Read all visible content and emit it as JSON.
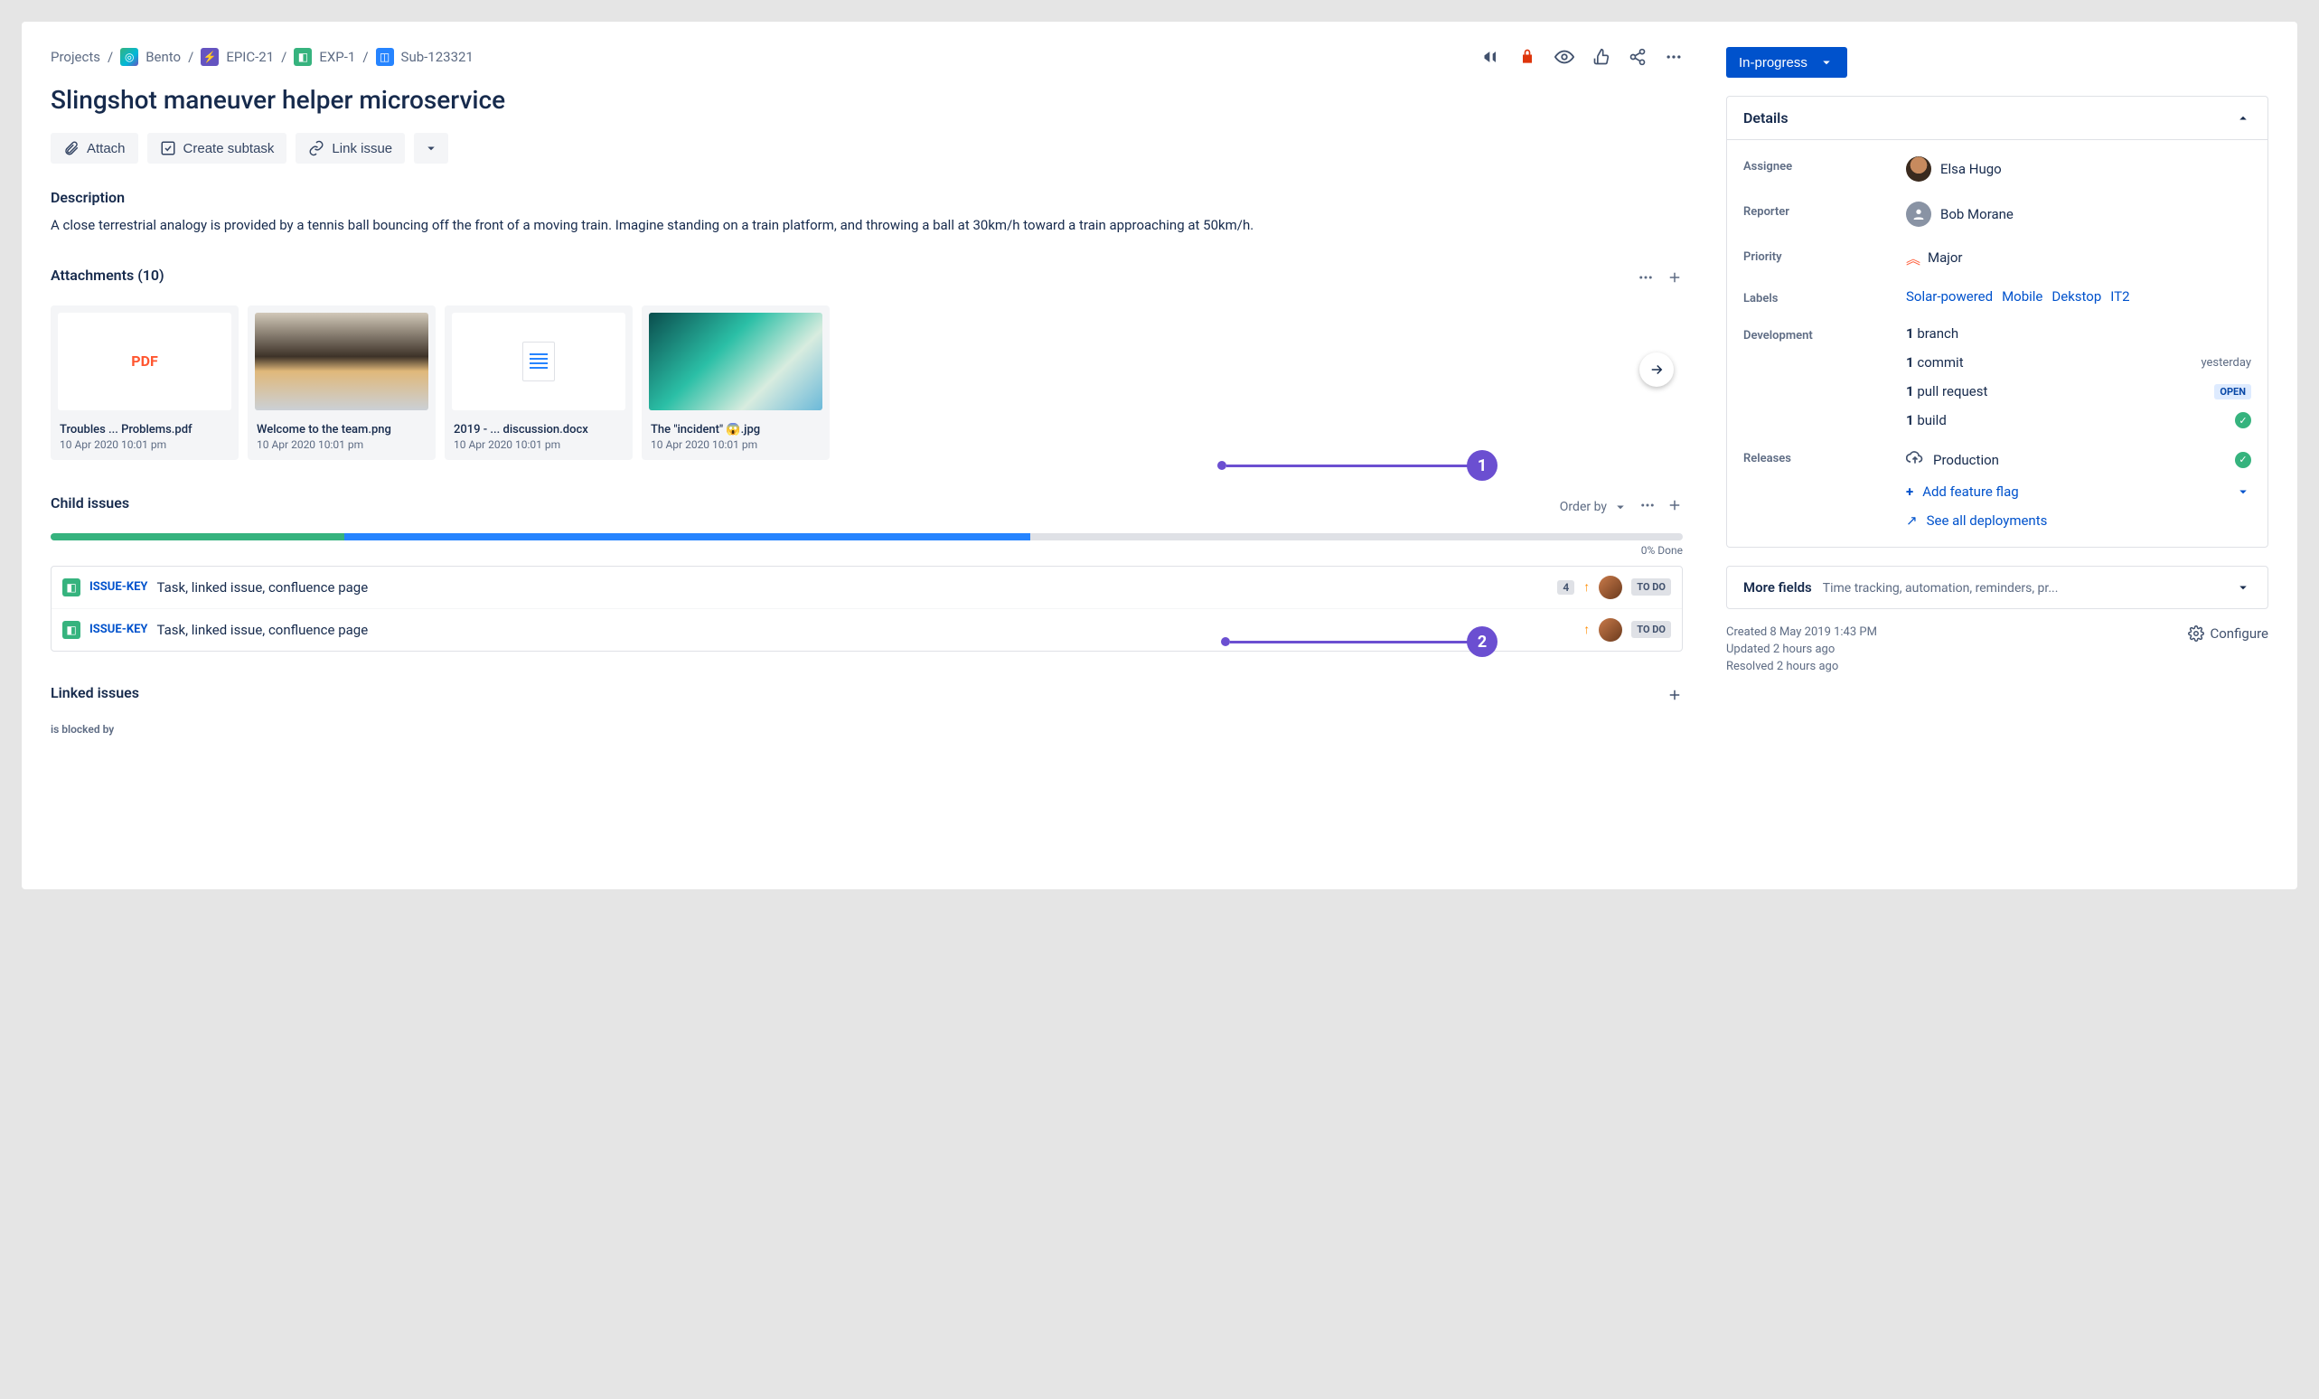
{
  "breadcrumbs": {
    "root": "Projects",
    "project": "Bento",
    "epic": "EPIC-21",
    "exp": "EXP-1",
    "sub": "Sub-123321"
  },
  "title": "Slingshot maneuver helper microservice",
  "actions": {
    "attach": "Attach",
    "subtask": "Create subtask",
    "link": "Link issue"
  },
  "description": {
    "label": "Description",
    "text": "A close terrestrial analogy is provided by a tennis ball bouncing off the front of a moving train. Imagine standing on a train platform, and throwing a ball at 30km/h toward a train approaching at 50km/h."
  },
  "attachments": {
    "label": "Attachments (10)",
    "items": [
      {
        "name": "Troubles ... Problems.pdf",
        "date": "10 Apr 2020 10:01 pm",
        "type": "pdf",
        "thumb_text": "PDF"
      },
      {
        "name": "Welcome to the team.png",
        "date": "10 Apr 2020 10:01 pm",
        "type": "img1"
      },
      {
        "name": "2019 - ... discussion.docx",
        "date": "10 Apr 2020 10:01 pm",
        "type": "doc"
      },
      {
        "name": "The \"incident\" 😱.jpg",
        "date": "10 Apr 2020 10:01 pm",
        "type": "img2"
      }
    ]
  },
  "childIssues": {
    "label": "Child issues",
    "order_by": "Order by",
    "done": "0% Done",
    "rows": [
      {
        "key": "ISSUE-KEY",
        "summary": "Task, linked issue, confluence page",
        "count": "4",
        "status": "TO DO"
      },
      {
        "key": "ISSUE-KEY",
        "summary": "Task, linked issue, confluence page",
        "status": "TO DO"
      }
    ]
  },
  "linked": {
    "label": "Linked issues",
    "blocked": "is blocked by"
  },
  "status": {
    "label": "In-progress"
  },
  "details": {
    "heading": "Details",
    "assignee": {
      "label": "Assignee",
      "name": "Elsa Hugo"
    },
    "reporter": {
      "label": "Reporter",
      "name": "Bob Morane"
    },
    "priority": {
      "label": "Priority",
      "value": "Major"
    },
    "labels": {
      "label": "Labels",
      "items": [
        "Solar-powered",
        "Mobile",
        "Dekstop",
        "IT2"
      ]
    },
    "development": {
      "label": "Development",
      "branch": {
        "count": "1",
        "text": "branch"
      },
      "commit": {
        "count": "1",
        "text": "commit",
        "meta": "yesterday"
      },
      "pr": {
        "count": "1",
        "text": "pull request",
        "badge": "OPEN"
      },
      "build": {
        "count": "1",
        "text": "build"
      }
    },
    "releases": {
      "label": "Releases",
      "prod": "Production",
      "add_flag": "Add feature flag",
      "see_all": "See all deployments"
    }
  },
  "moreFields": {
    "label": "More fields",
    "hint": "Time tracking, automation, reminders, pr..."
  },
  "metaFooter": {
    "created": "Created 8 May 2019 1:43 PM",
    "updated": "Updated 2 hours ago",
    "resolved": "Resolved 2 hours ago",
    "configure": "Configure"
  },
  "annotations": {
    "one": "1",
    "two": "2"
  }
}
